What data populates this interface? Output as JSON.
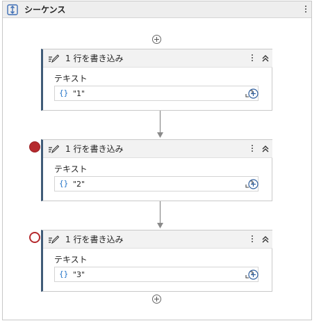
{
  "sequence": {
    "title": "シーケンス",
    "icon": "sequence-icon",
    "menu_icon": "kebab-menu-icon"
  },
  "activities": [
    {
      "title": "1 行を書き込み",
      "field_label": "テキスト",
      "value": "\"1\"",
      "icon": "write-line-icon",
      "breakpoint": "none"
    },
    {
      "title": "1 行を書き込み",
      "field_label": "テキスト",
      "value": "\"2\"",
      "icon": "write-line-icon",
      "breakpoint": "enabled"
    },
    {
      "title": "1 行を書き込み",
      "field_label": "テキスト",
      "value": "\"3\"",
      "icon": "write-line-icon",
      "breakpoint": "disabled"
    }
  ],
  "expression_glyph": "{}",
  "colors": {
    "accent_border": "#3f5b78",
    "expression_blue": "#1f72c8",
    "breakpoint_red": "#b52a2e",
    "header_bg": "#eeeeee"
  }
}
